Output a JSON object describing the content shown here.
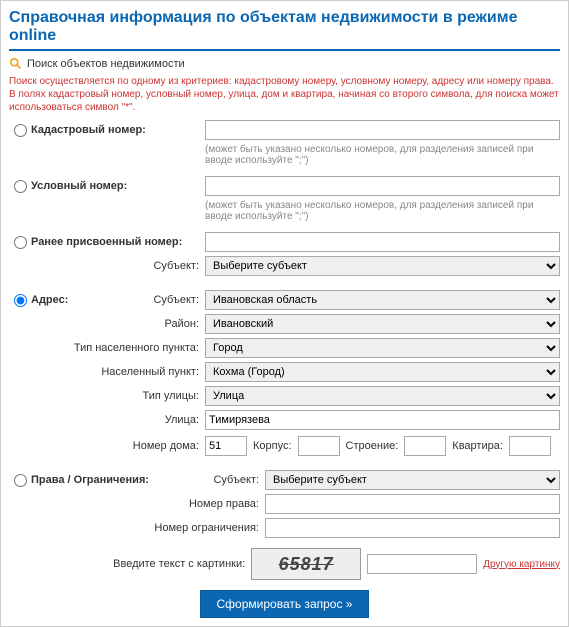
{
  "title": "Справочная информация по объектам недвижимости в режиме online",
  "searchHeader": "Поиск объектов недвижимости",
  "hint1": "Поиск осуществляется по одному из критериев: кадастровому номеру, условному номеру, адресу или номеру права.",
  "hint2": "В полях кадастровый номер, условный номер, улица, дом и квартира, начиная со второго символа, для поиска может использоваться символ \"*\".",
  "cadastral": {
    "label": "Кадастровый номер:",
    "value": ""
  },
  "conditional": {
    "label": "Условный номер:",
    "value": ""
  },
  "multiNote": "(может быть указано несколько номеров, для разделения записей при вводе используйте \";\")",
  "prev": {
    "label": "Ранее присвоенный номер:",
    "value": "",
    "subjectLabel": "Субъект:",
    "subject": "Выберите субъект"
  },
  "address": {
    "label": "Адрес:",
    "subjectLabel": "Субъект:",
    "subject": "Ивановская область",
    "rayonLabel": "Район:",
    "rayon": "Ивановский",
    "typeNpLabel": "Тип населенного пункта:",
    "typeNp": "Город",
    "npLabel": "Населенный пункт:",
    "np": "Кохма (Город)",
    "streetTypeLabel": "Тип улицы:",
    "streetType": "Улица",
    "streetLabel": "Улица:",
    "street": "Тимирязева",
    "houseLabel": "Номер дома:",
    "house": "51",
    "korpusLabel": "Корпус:",
    "korpus": "",
    "buildLabel": "Строение:",
    "build": "",
    "flatLabel": "Квартира:",
    "flat": ""
  },
  "rights": {
    "label": "Права / Ограничения:",
    "subjectLabel": "Субъект:",
    "subject": "Выберите субъект",
    "numRightLabel": "Номер права:",
    "numRight": "",
    "numLimitLabel": "Номер ограничения:",
    "numLimit": ""
  },
  "captcha": {
    "label": "Введите текст с картинки:",
    "text": "65817",
    "link": "Другую картинку",
    "value": ""
  },
  "submit": "Сформировать запрос »"
}
